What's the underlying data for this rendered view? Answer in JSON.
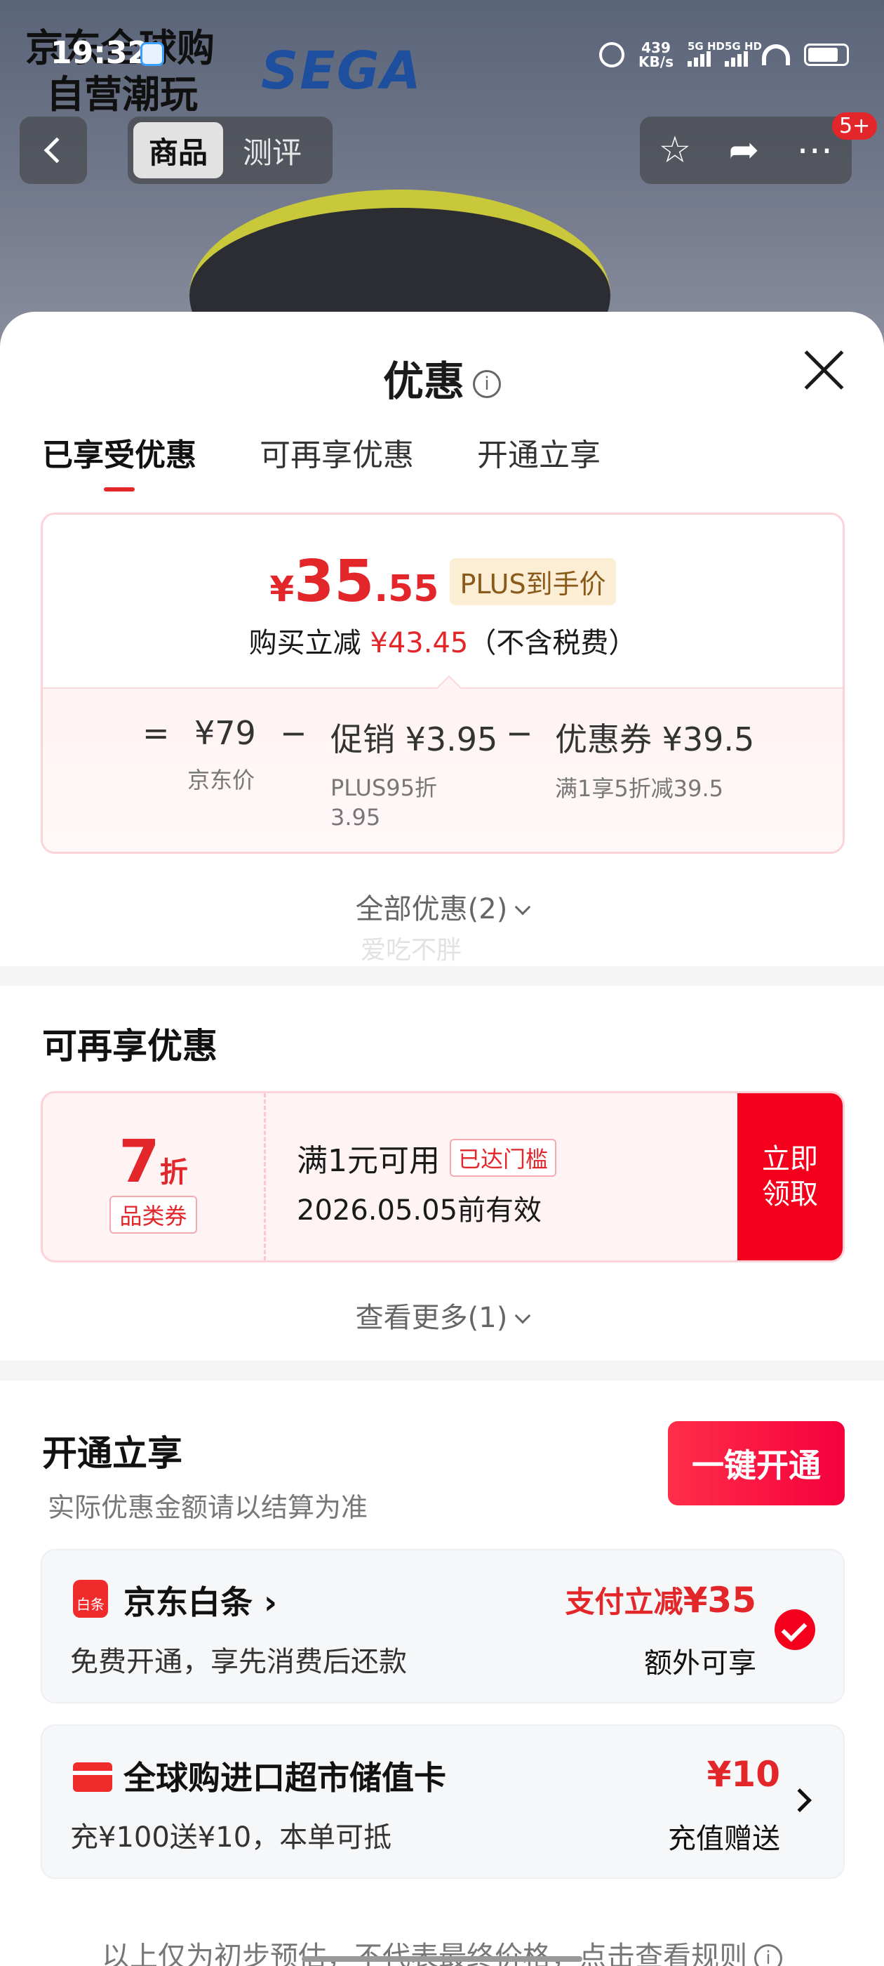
{
  "status_bar": {
    "time": "19:32",
    "speed": "439",
    "speed_unit": "KB/s",
    "sig1": "5G HD",
    "sig2": "5G HD"
  },
  "background": {
    "store_line1": "京东全球购",
    "store_line2": "自营潮玩",
    "brand_logo": "SEGA"
  },
  "nav": {
    "tabs": [
      "商品",
      "测评"
    ],
    "badge": "5+"
  },
  "sheet": {
    "title": "优惠",
    "tabs": [
      "已享受优惠",
      "可再享优惠",
      "开通立享"
    ],
    "summary": {
      "currency": "¥",
      "price_int": "35",
      "price_dec": ".55",
      "plus_tag": "PLUS到手价",
      "reduce_prefix": "购买立减",
      "reduce_amount": "¥43.45",
      "reduce_suffix": "（不含税费）",
      "calc": [
        {
          "main": "¥79",
          "sub": "京东价"
        },
        {
          "main": "促销 ¥3.95",
          "sub_1": "PLUS95折",
          "sub_2": "3.95"
        },
        {
          "main": "优惠券 ¥39.5",
          "sub": "满1享5折减39.5"
        }
      ],
      "ops": [
        "=",
        "−",
        "−"
      ]
    },
    "all_offers": "全部优惠(2)",
    "faint_name": "爱吃不胖",
    "more_section": {
      "title": "可再享优惠",
      "coupon": {
        "discount": "7",
        "discount_unit": "折",
        "category": "品类券",
        "condition": "满1元可用",
        "reached": "已达门槛",
        "valid": "2026.05.05前有效",
        "claim_1": "立即",
        "claim_2": "领取"
      },
      "see_more": "查看更多(1)"
    },
    "open_section": {
      "title": "开通立享",
      "subtitle": "实际优惠金额请以结算为准",
      "button": "一键开通",
      "baitiao": {
        "name": "京东白条",
        "icon_text": "白条",
        "desc": "免费开通，享先消费后还款",
        "amount_prefix": "支付立减",
        "amount": "¥35",
        "note": "额外可享"
      },
      "card": {
        "name": "全球购进口超市储值卡",
        "desc": "充¥100送¥10，本单可抵",
        "amount": "¥10",
        "note": "充值赠送"
      }
    },
    "footer": "以上仅为初步预估，不代表最终价格，点击查看规则"
  },
  "colors": {
    "accent_red": "#e3262a",
    "claim_red": "#f4001c",
    "plus_gold": "#8a5a1a"
  }
}
